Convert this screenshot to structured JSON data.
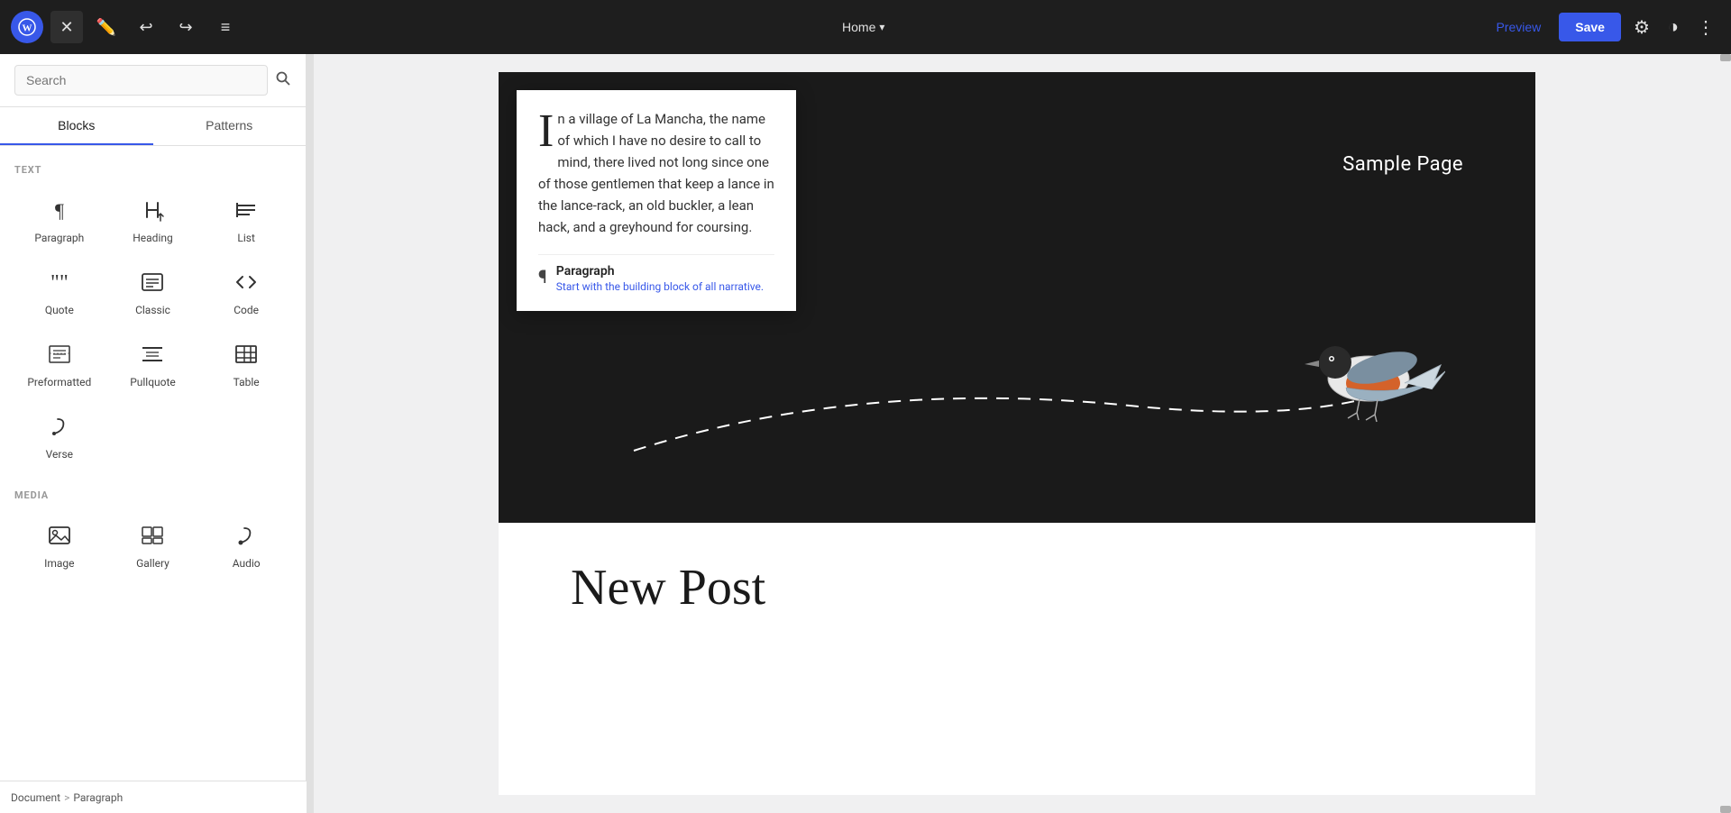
{
  "topbar": {
    "wp_logo": "W",
    "close_label": "✕",
    "undo_label": "↩",
    "redo_label": "↪",
    "tools_label": "≡",
    "nav_title": "Home",
    "preview_label": "Preview",
    "save_label": "Save",
    "settings_label": "⚙",
    "contrast_label": "◑",
    "more_label": "⋮"
  },
  "sidebar": {
    "search_placeholder": "Search",
    "search_icon": "🔍",
    "tab_blocks": "Blocks",
    "tab_patterns": "Patterns",
    "text_section_label": "TEXT",
    "media_section_label": "MEDIA",
    "blocks": [
      {
        "id": "paragraph",
        "icon": "¶",
        "label": "Paragraph"
      },
      {
        "id": "heading",
        "icon": "🔖",
        "label": "Heading"
      },
      {
        "id": "list",
        "icon": "≡",
        "label": "List"
      },
      {
        "id": "quote",
        "icon": "❝",
        "label": "Quote"
      },
      {
        "id": "classic",
        "icon": "⌨",
        "label": "Classic"
      },
      {
        "id": "code",
        "icon": "<>",
        "label": "Code"
      },
      {
        "id": "preformatted",
        "icon": "▤",
        "label": "Preformatted"
      },
      {
        "id": "pullquote",
        "icon": "≡",
        "label": "Pullquote"
      },
      {
        "id": "table",
        "icon": "⊞",
        "label": "Table"
      },
      {
        "id": "verse",
        "icon": "✒",
        "label": "Verse"
      }
    ],
    "media_blocks": [
      {
        "id": "image",
        "icon": "🖼",
        "label": "Image"
      },
      {
        "id": "gallery",
        "icon": "▣",
        "label": "Gallery"
      },
      {
        "id": "audio",
        "icon": "♪",
        "label": "Audio"
      }
    ]
  },
  "breadcrumb": {
    "items": [
      "Document",
      ">",
      "Paragraph"
    ]
  },
  "canvas": {
    "sample_page": "Sample Page",
    "content_text": "n a village of La Mancha, the name of which I have no desire to call to mind, there lived not long since one of those gentlemen that keep a lance in the lance-rack, an old buckler, a lean hack, and a greyhound for coursing.",
    "dropcap": "I",
    "paragraph_label": "Paragraph",
    "paragraph_desc": "Start with the building block of all narrative.",
    "post_title": "New Post"
  }
}
